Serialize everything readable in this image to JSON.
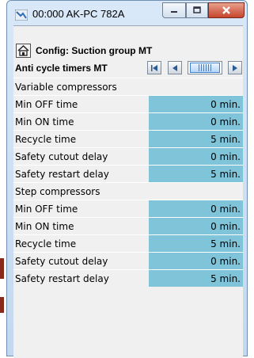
{
  "window": {
    "title": "00:000 AK-PC 782A",
    "accent": "#7fc4d9"
  },
  "config": {
    "title": "Config: Suction group MT",
    "home_icon": "home-icon"
  },
  "nav": {
    "title": "Anti cycle timers MT",
    "first_icon": "first-page-icon",
    "prev_icon": "previous-page-icon",
    "next_icon": "next-page-icon"
  },
  "sections": [
    {
      "title": "Variable compressors",
      "rows": [
        {
          "label": "Min OFF time",
          "value": "0 min."
        },
        {
          "label": "Min ON time",
          "value": "0 min."
        },
        {
          "label": "Recycle time",
          "value": "5 min."
        },
        {
          "label": "Safety cutout delay",
          "value": "0 min."
        },
        {
          "label": "Safety restart delay",
          "value": "5 min."
        }
      ]
    },
    {
      "title": "Step compressors",
      "rows": [
        {
          "label": "Min OFF time",
          "value": "0 min."
        },
        {
          "label": "Min ON time",
          "value": "0 min."
        },
        {
          "label": "Recycle time",
          "value": "5 min."
        },
        {
          "label": "Safety cutout delay",
          "value": "0 min."
        },
        {
          "label": "Safety restart delay",
          "value": "5 min."
        }
      ]
    }
  ]
}
